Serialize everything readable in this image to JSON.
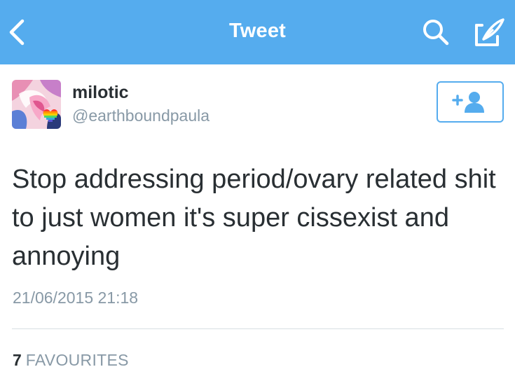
{
  "navbar": {
    "title": "Tweet",
    "back_icon": "chevron-left-icon",
    "search_icon": "search-icon",
    "compose_icon": "compose-icon",
    "color": "#55acee"
  },
  "tweet": {
    "author_name": "milotic",
    "author_handle": "@earthboundpaula",
    "text": "Stop addressing period/ovary related shit to just women it's super cissexist and annoying",
    "timestamp": "21/06/2015 21:18",
    "favourites_count": "7",
    "favourites_label": "FAVOURITES",
    "follow_icon": "add-user-icon"
  }
}
